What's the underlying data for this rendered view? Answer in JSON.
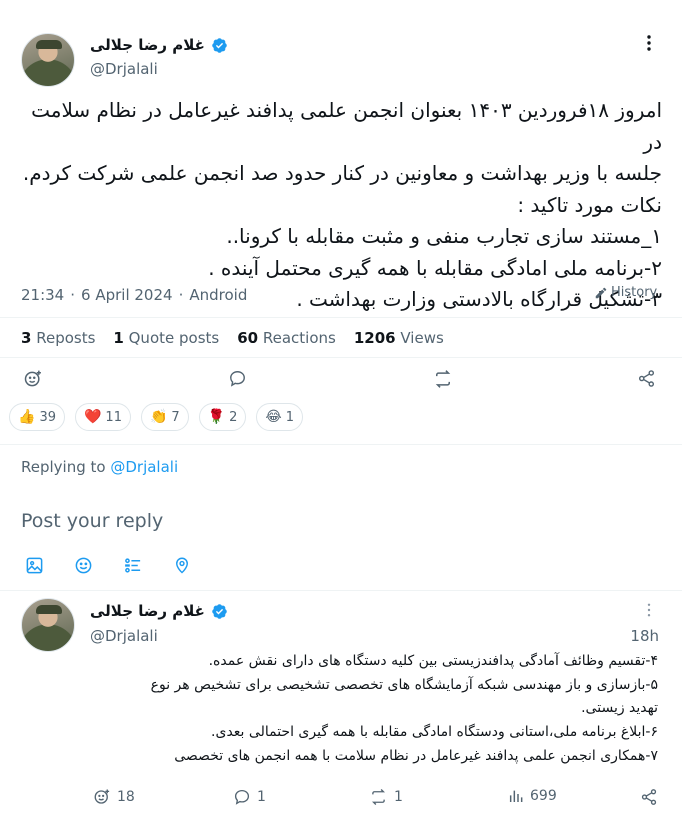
{
  "tweet": {
    "author_name": "غلام رضا جلالی",
    "handle": "@Drjalali",
    "lines": [
      "امروز ۱۸فروردین ۱۴۰۳ بعنوان انجمن علمی پدافند غیرعامل در نظام سلامت در",
      "جلسه با وزیر بهداشت و معاونین در کنار حدود صد انجمن علمی شرکت کردم.",
      "نکات مورد تاکید :",
      "۱_مستند سازی تجارب منفی و مثبت مقابله با کرونا..",
      "۲-برنامه ملی امادگی مقابله با همه گیری محتمل آینده .",
      "۳-تشکیل قرارگاه بالادستی وزارت بهداشت ."
    ],
    "time": "21:34",
    "date": "6 April 2024",
    "separator": "·",
    "client": "Android",
    "history_label": "History"
  },
  "stats": {
    "reposts_count": "3",
    "reposts_label": "Reposts",
    "quotes_count": "1",
    "quotes_label": "Quote posts",
    "reactions_count": "60",
    "reactions_label": "Reactions",
    "views_count": "1206",
    "views_label": "Views"
  },
  "reactions": [
    {
      "emoji": "👍",
      "count": "39"
    },
    {
      "emoji": "❤️",
      "count": "11"
    },
    {
      "emoji": "👏",
      "count": "7"
    },
    {
      "emoji": "🌹",
      "count": "2"
    },
    {
      "emoji": "😂",
      "count": "1"
    }
  ],
  "reply_context": {
    "prefix": "Replying to",
    "handle": "@Drjalali"
  },
  "compose": {
    "placeholder": "Post your reply"
  },
  "reply": {
    "author_name": "غلام رضا جلالی",
    "handle": "@Drjalali",
    "time_ago": "18h",
    "lines": [
      "۴-تقسیم وظائف آمادگی پدافندزیستی بین کلیه دستگاه های دارای نقش عمده.",
      "۵-بازسازی و باز مهندسی شبکه آزمایشگاه های تخصصی تشخیصی برای تشخیص هر نوع",
      "تهدید زیستی.",
      "۶-ابلاغ برنامه ملی،استانی ودستگاه امادگی مقابله با همه گیری احتمالی بعدی.",
      "۷-همکاری انجمن علمی پدافند غیرعامل در نظام سلامت با همه انجمن های تخصصی"
    ],
    "reactions_count": "18",
    "replies_count": "1",
    "reposts_count": "1",
    "views_count": "699"
  },
  "colors": {
    "accent": "#1d9bf0",
    "text": "#0f1419",
    "muted": "#536471",
    "divider": "#eff3f4"
  }
}
